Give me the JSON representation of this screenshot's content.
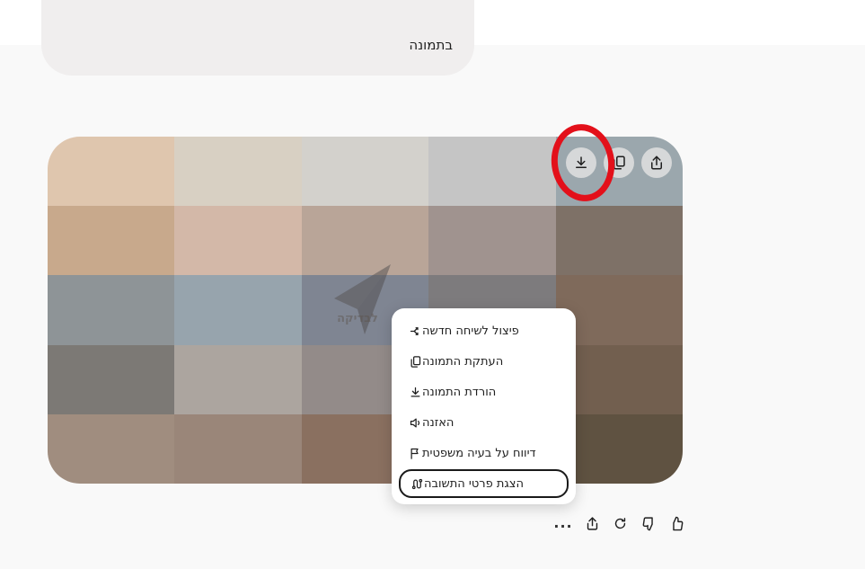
{
  "user_message": {
    "text": "בתמונה"
  },
  "image": {
    "watermark_text": "לבדיקה",
    "tile_colors": [
      "#dfc6ae",
      "#d8d0c3",
      "#d3d1cc",
      "#c5c5c5",
      "#9ba7ad",
      "#c8a98c",
      "#d3b8a8",
      "#b9a598",
      "#a0938f",
      "#7e7167",
      "#8e9497",
      "#97a4ad",
      "#7f8592",
      "#7d7b7d",
      "#7f6a5b",
      "#7c7975",
      "#aca59f",
      "#938b89",
      "#9e8b83",
      "#725f4f",
      "#a08d7f",
      "#9a8679",
      "#8a7060",
      "#7a6757",
      "#5f5241"
    ],
    "buttons": [
      {
        "name": "download-image-button",
        "icon": "download-icon"
      },
      {
        "name": "copy-image-button",
        "icon": "copy-icon"
      },
      {
        "name": "share-image-button",
        "icon": "share-icon"
      }
    ]
  },
  "annotation": {
    "color": "#e3101a"
  },
  "context_menu": {
    "items": [
      {
        "label": "פיצול לשיחה חדשה",
        "icon": "branch-icon"
      },
      {
        "label": "העתקת התמונה",
        "icon": "copy-icon"
      },
      {
        "label": "הורדת התמונה",
        "icon": "download-icon"
      },
      {
        "label": "האזנה",
        "icon": "speaker-icon"
      },
      {
        "label": "דיווח על בעיה משפטית",
        "icon": "flag-icon"
      },
      {
        "label": "הצגת פרטי התשובה",
        "icon": "route-icon"
      }
    ],
    "highlighted_index": 5
  },
  "actions": {
    "more_label": "...",
    "items": [
      "share-icon",
      "retry-icon",
      "thumbs-down-icon",
      "thumbs-up-icon"
    ]
  }
}
